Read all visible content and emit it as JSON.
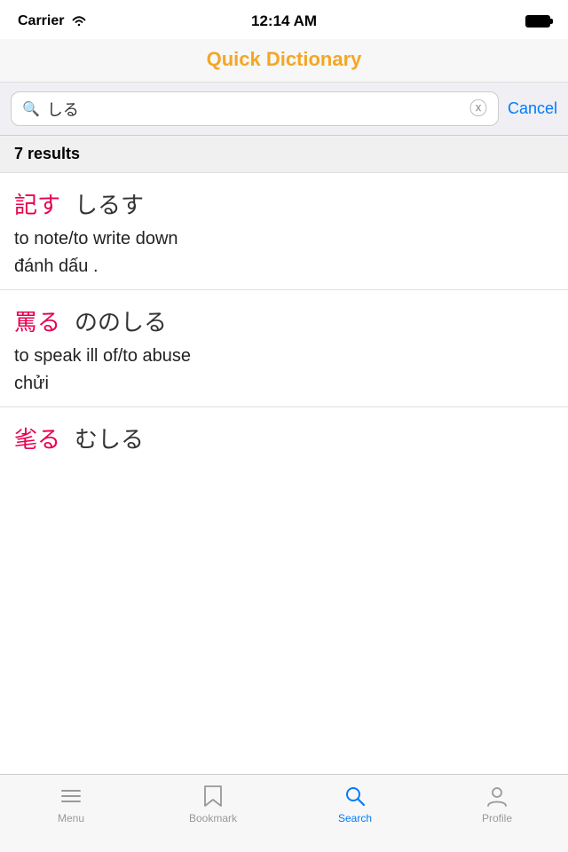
{
  "statusBar": {
    "carrier": "Carrier",
    "time": "12:14 AM"
  },
  "header": {
    "title": "Quick Dictionary"
  },
  "searchBar": {
    "value": "しる",
    "cancelLabel": "Cancel"
  },
  "results": {
    "count": "7 results",
    "entries": [
      {
        "kanji": "記す",
        "reading": "しるす",
        "def_en": "to note/to write down",
        "def_vi": "đánh dấu ."
      },
      {
        "kanji": "罵る",
        "reading": "ののしる",
        "def_en": "to speak ill of/to abuse",
        "def_vi": "chửi"
      },
      {
        "kanji": "毟る",
        "reading": "むしる",
        "def_en": "",
        "def_vi": ""
      }
    ]
  },
  "tabBar": {
    "items": [
      {
        "id": "menu",
        "label": "Menu",
        "active": false
      },
      {
        "id": "bookmark",
        "label": "Bookmark",
        "active": false
      },
      {
        "id": "search",
        "label": "Search",
        "active": true
      },
      {
        "id": "profile",
        "label": "Profile",
        "active": false
      }
    ]
  }
}
